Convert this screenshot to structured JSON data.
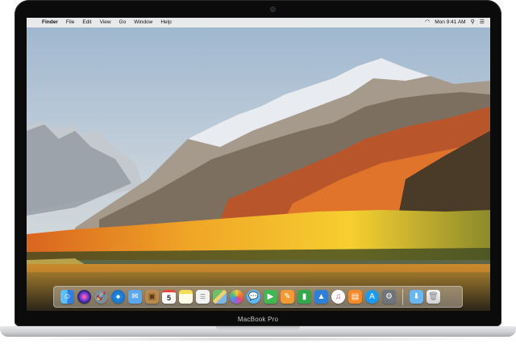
{
  "menubar": {
    "apple": "",
    "items": [
      "Finder",
      "File",
      "Edit",
      "View",
      "Go",
      "Window",
      "Help"
    ],
    "clock": "Mon 9:41 AM"
  },
  "device": {
    "label": "MacBook Pro"
  },
  "dock": {
    "apps": [
      {
        "icon": "finder-icon",
        "color": "#2f8fe8"
      },
      {
        "icon": "siri-icon",
        "color": "#3b2a6b"
      },
      {
        "icon": "launchpad-icon",
        "color": "#6d7a88"
      },
      {
        "icon": "safari-icon",
        "color": "#1f8ae0"
      },
      {
        "icon": "mail-icon",
        "color": "#5aa9f0"
      },
      {
        "icon": "contacts-icon",
        "color": "#b98a4b"
      },
      {
        "icon": "calendar-icon",
        "color": "#ffffff",
        "text": "5"
      },
      {
        "icon": "notes-icon",
        "color": "#f5dd56"
      },
      {
        "icon": "reminders-icon",
        "color": "#f2f2f2"
      },
      {
        "icon": "maps-icon",
        "color": "#6fc06a"
      },
      {
        "icon": "photos-icon",
        "color": "#f4f4f4"
      },
      {
        "icon": "messages-icon",
        "color": "#4cc36a"
      },
      {
        "icon": "facetime-icon",
        "color": "#3fb752"
      },
      {
        "icon": "pages-icon",
        "color": "#f29b35"
      },
      {
        "icon": "numbers-icon",
        "color": "#31a94a"
      },
      {
        "icon": "keynote-icon",
        "color": "#2d7fd8"
      },
      {
        "icon": "itunes-icon",
        "color": "#e84c7d"
      },
      {
        "icon": "ibooks-icon",
        "color": "#f28a2a"
      },
      {
        "icon": "app-store-icon",
        "color": "#1b9af1"
      },
      {
        "icon": "system-preferences-icon",
        "color": "#8a8f96"
      }
    ],
    "extras": [
      {
        "icon": "downloads-folder-icon",
        "color": "#69b7ee"
      },
      {
        "icon": "trash-icon",
        "color": "#e2e4e7"
      }
    ]
  }
}
